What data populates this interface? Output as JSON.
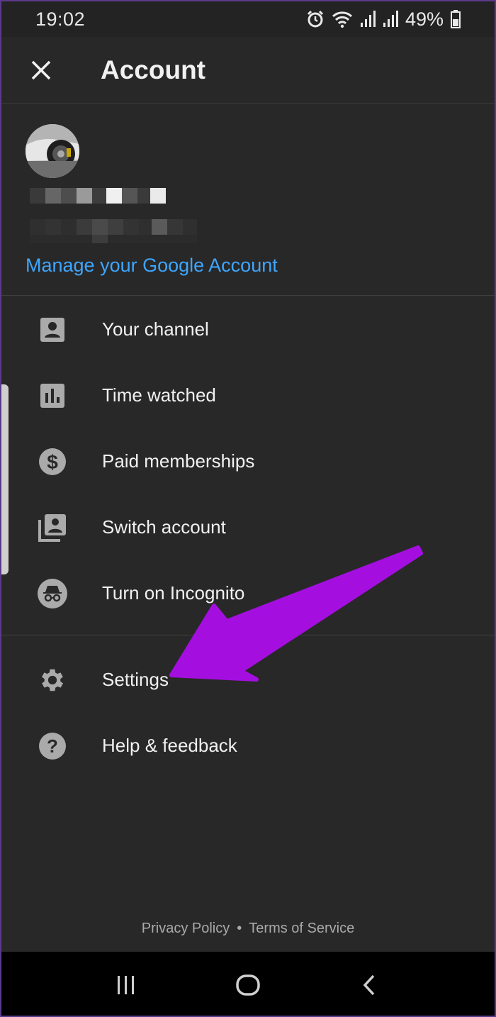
{
  "status_bar": {
    "time": "19:02",
    "battery": "49%",
    "icons": [
      "alarm-icon",
      "wifi-icon",
      "signal-icon",
      "signal-icon",
      "battery-icon"
    ]
  },
  "header": {
    "close_icon": "close-icon",
    "title": "Account"
  },
  "profile": {
    "manage_link": "Manage your Google Account"
  },
  "menu": {
    "group1": [
      {
        "label": "Your channel",
        "icon": "person-box-icon"
      },
      {
        "label": "Time watched",
        "icon": "bar-chart-icon"
      },
      {
        "label": "Paid memberships",
        "icon": "dollar-circle-icon"
      },
      {
        "label": "Switch account",
        "icon": "switch-account-icon"
      },
      {
        "label": "Turn on Incognito",
        "icon": "incognito-icon"
      }
    ],
    "group2": [
      {
        "label": "Settings",
        "icon": "gear-icon"
      },
      {
        "label": "Help & feedback",
        "icon": "help-icon"
      }
    ]
  },
  "footer": {
    "privacy": "Privacy Policy",
    "separator": "•",
    "terms": "Terms of Service"
  },
  "nav_bar": {
    "icons": [
      "recent-apps-icon",
      "home-icon",
      "back-icon"
    ]
  },
  "colors": {
    "background": "#282828",
    "link": "#3ea6ff",
    "annotation_arrow": "#a40fe0"
  }
}
